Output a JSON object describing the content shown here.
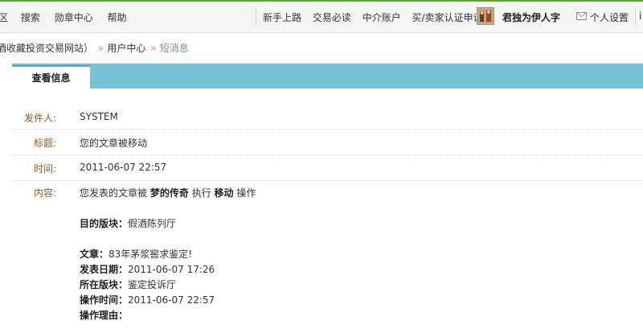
{
  "topnav": {
    "left_items": [
      "区",
      "搜索",
      "勋章中心",
      "帮助"
    ],
    "right_items": [
      "新手上路",
      "交易必读",
      "中介账户",
      "买/卖家认证申请"
    ],
    "username": "君独为伊人字",
    "settings_label": "个人设置",
    "more_partial": "i"
  },
  "breadcrumb": {
    "site": "酒收藏投资交易网站）",
    "user_center": "用户中心",
    "current": "短消息"
  },
  "tab": {
    "label": "查看信息"
  },
  "message": {
    "sender_label": "发件人:",
    "sender": "SYSTEM",
    "title_label": "标题:",
    "title": "您的文章被移动",
    "time_label": "时间:",
    "time": "2011-06-07 22:57",
    "content_label": "内容:",
    "line1_prefix": "您发表的文章被",
    "line1_user": "梦的传奇",
    "line1_mid": "执行",
    "line1_action": "移动",
    "line1_suffix": "操作",
    "target_board_label": "目的版块：",
    "target_board": "假酒陈列厅",
    "article_label": "文章：",
    "article": "83年茅浆窖求鉴定!",
    "post_date_label": "发表日期：",
    "post_date": "2011-06-07 17:26",
    "board_label": "所在版块：",
    "board": "鉴定投诉厅",
    "op_time_label": "操作时间：",
    "op_time": "2011-06-07 22:57",
    "reason_label": "操作理由："
  },
  "colors": {
    "tab_bar": "#78c2d6",
    "label_brown": "#8a5a2a",
    "top_accent_green": "#5fa32e"
  }
}
